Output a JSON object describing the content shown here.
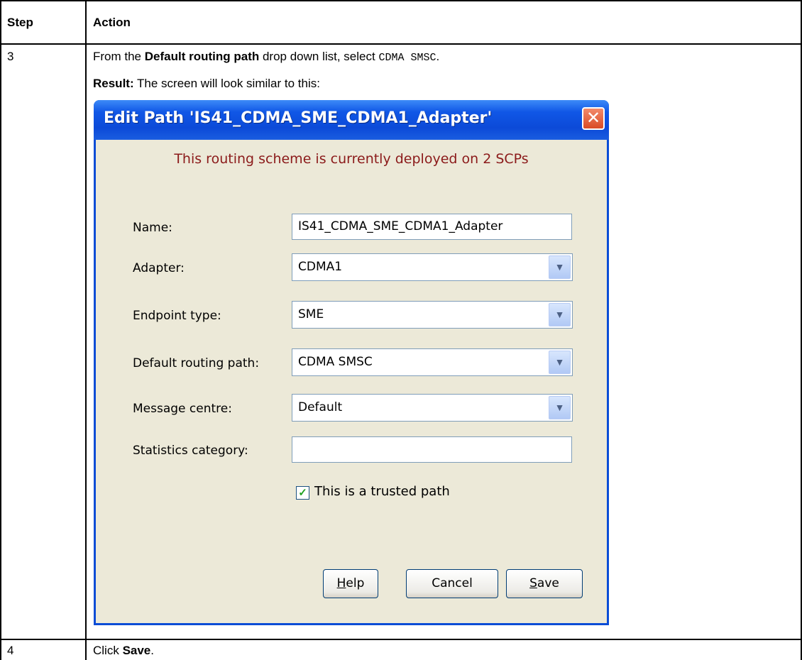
{
  "table": {
    "header": {
      "step": "Step",
      "action": "Action"
    },
    "rows": [
      {
        "step": "3",
        "instruction": {
          "prefix": "From the ",
          "bold": "Default routing path",
          "middle": " drop down list, select ",
          "code": "CDMA SMSC",
          "suffix": "."
        },
        "result": {
          "bold": "Result:",
          "text": " The screen will look similar to this:"
        }
      },
      {
        "step": "4",
        "instruction": {
          "prefix": "Click ",
          "bold": "Save",
          "suffix": "."
        }
      }
    ]
  },
  "dialog": {
    "title": "Edit Path 'IS41_CDMA_SME_CDMA1_Adapter'",
    "close_icon": "close-icon",
    "notice": "This routing scheme is currently deployed on 2 SCPs",
    "fields": {
      "name": {
        "label": "Name:",
        "value": "IS41_CDMA_SME_CDMA1_Adapter"
      },
      "adapter": {
        "label": "Adapter:",
        "value": "CDMA1"
      },
      "endpoint_type": {
        "label": "Endpoint type:",
        "value": "SME"
      },
      "default_routing_path": {
        "label": "Default routing path:",
        "value": "CDMA SMSC"
      },
      "message_centre": {
        "label": "Message centre:",
        "value": "Default"
      },
      "statistics_category": {
        "label": "Statistics category:",
        "value": ""
      }
    },
    "trusted_path": {
      "label": "This is a trusted path",
      "checked": true
    },
    "buttons": {
      "help": {
        "accel": "H",
        "rest": "elp"
      },
      "cancel": "Cancel",
      "save": {
        "accel": "S",
        "rest": "ave"
      }
    }
  }
}
